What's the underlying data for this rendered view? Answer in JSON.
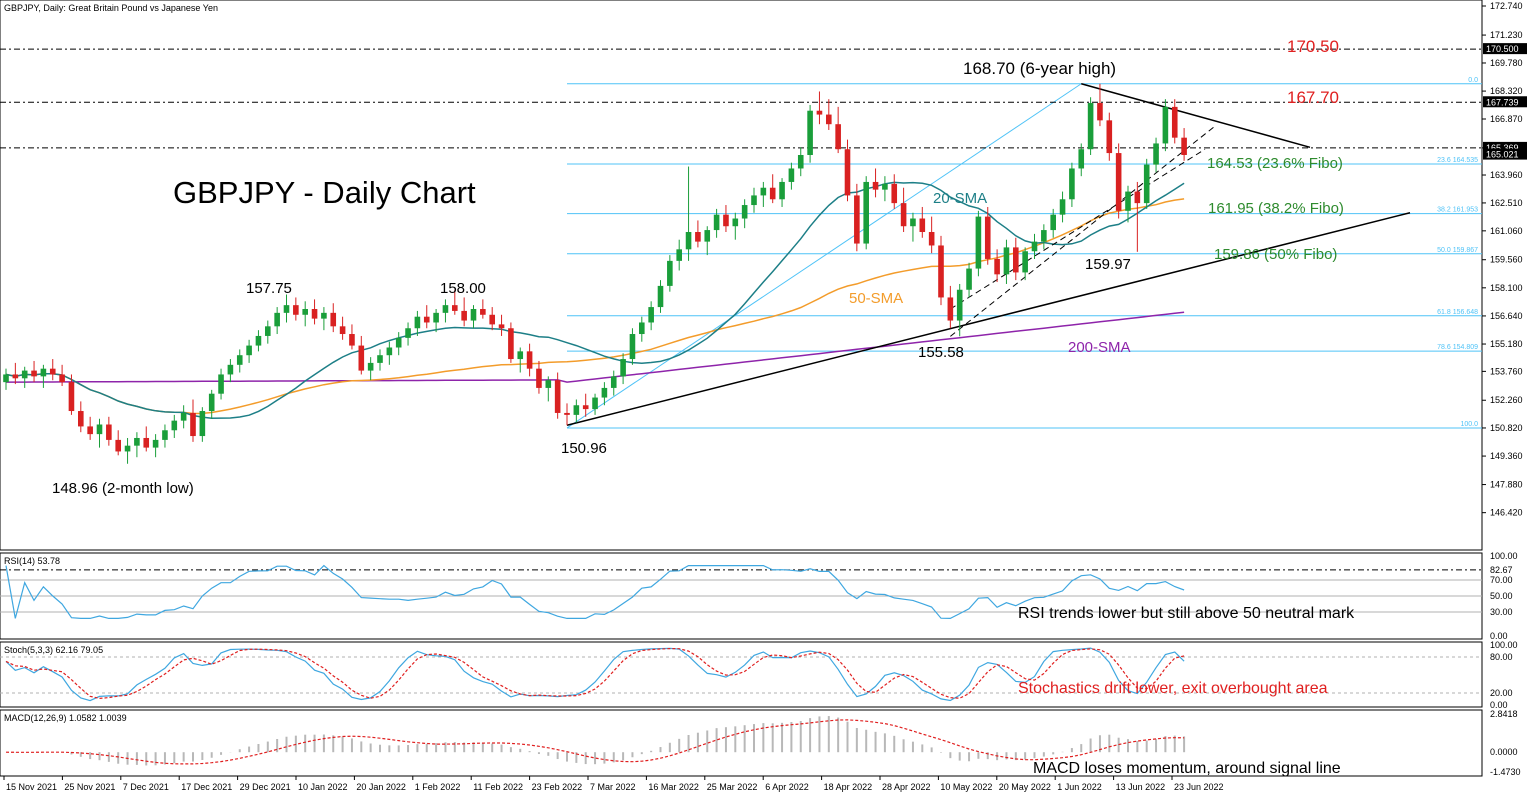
{
  "header": {
    "symbol_info": "GBPJPY, Daily:  Great Britain Pound vs Japanese Yen",
    "chart_title": "GBPJPY - Daily Chart"
  },
  "colors": {
    "bull": "#1a9e3a",
    "bear": "#d92121",
    "sma20": "#1d7f87",
    "sma50": "#f39c2b",
    "sma200": "#8e24aa",
    "fib": "#4fc3f7",
    "annotation_red": "#e02020",
    "annotation_green": "#2e8b2e",
    "rsi": "#3fa7e0",
    "stoch_main": "#3fa7e0",
    "stoch_signal": "#e02020",
    "macd_hist": "#b8b8b8",
    "macd_signal": "#e02020"
  },
  "chart_data": [
    {
      "type": "candlestick",
      "title": "GBPJPY - Daily Chart",
      "ylim": [
        145.0,
        172.74
      ],
      "y_ticks": [
        "172.740",
        "171.230",
        "169.780",
        "168.320",
        "166.870",
        "165.369",
        "163.960",
        "162.510",
        "161.060",
        "159.560",
        "158.100",
        "156.640",
        "155.180",
        "153.760",
        "152.260",
        "150.820",
        "149.360",
        "147.880",
        "146.420"
      ],
      "x_tick_labels": [
        "15 Nov 2021",
        "25 Nov 2021",
        "7 Dec 2021",
        "17 Dec 2021",
        "29 Dec 2021",
        "10 Jan 2022",
        "20 Jan 2022",
        "1 Feb 2022",
        "11 Feb 2022",
        "23 Feb 2022",
        "7 Mar 2022",
        "16 Mar 2022",
        "25 Mar 2022",
        "6 Apr 2022",
        "18 Apr 2022",
        "28 Apr 2022",
        "10 May 2022",
        "20 May 2022",
        "1 Jun 2022",
        "13 Jun 2022",
        "23 Jun 2022"
      ],
      "ohlc": [
        [
          153.2,
          153.9,
          152.8,
          153.6
        ],
        [
          153.6,
          154.2,
          153.1,
          153.4
        ],
        [
          153.4,
          154.0,
          152.9,
          153.8
        ],
        [
          153.8,
          154.3,
          153.2,
          153.5
        ],
        [
          153.5,
          154.1,
          152.9,
          153.9
        ],
        [
          153.9,
          154.4,
          153.3,
          153.6
        ],
        [
          153.6,
          154.1,
          153.0,
          153.2
        ],
        [
          153.2,
          153.6,
          151.5,
          151.7
        ],
        [
          151.7,
          152.2,
          150.6,
          150.9
        ],
        [
          150.9,
          151.4,
          150.2,
          150.5
        ],
        [
          150.5,
          151.3,
          149.8,
          151.0
        ],
        [
          151.0,
          151.4,
          149.9,
          150.2
        ],
        [
          150.2,
          150.7,
          149.4,
          149.6
        ],
        [
          149.6,
          150.3,
          148.96,
          149.9
        ],
        [
          149.9,
          150.6,
          149.3,
          150.3
        ],
        [
          150.3,
          150.9,
          149.6,
          149.8
        ],
        [
          149.8,
          150.5,
          149.3,
          150.2
        ],
        [
          150.2,
          151.0,
          149.8,
          150.7
        ],
        [
          150.7,
          151.5,
          150.3,
          151.2
        ],
        [
          151.2,
          152.0,
          150.8,
          151.6
        ],
        [
          151.6,
          152.3,
          150.1,
          150.4
        ],
        [
          150.4,
          151.9,
          150.1,
          151.7
        ],
        [
          151.7,
          152.8,
          151.3,
          152.6
        ],
        [
          152.6,
          153.9,
          152.3,
          153.6
        ],
        [
          153.6,
          154.4,
          153.2,
          154.1
        ],
        [
          154.1,
          154.9,
          153.7,
          154.6
        ],
        [
          154.6,
          155.4,
          154.2,
          155.1
        ],
        [
          155.1,
          155.9,
          154.8,
          155.6
        ],
        [
          155.6,
          156.4,
          155.2,
          156.1
        ],
        [
          156.1,
          157.1,
          155.7,
          156.8
        ],
        [
          156.8,
          157.75,
          156.3,
          157.2
        ],
        [
          157.2,
          157.6,
          156.4,
          156.7
        ],
        [
          156.7,
          157.4,
          156.1,
          157.0
        ],
        [
          157.0,
          157.5,
          156.2,
          156.5
        ],
        [
          156.5,
          157.1,
          155.9,
          156.8
        ],
        [
          156.8,
          157.3,
          155.8,
          156.1
        ],
        [
          156.1,
          156.6,
          155.4,
          155.7
        ],
        [
          155.7,
          156.2,
          154.9,
          155.1
        ],
        [
          155.1,
          155.6,
          153.6,
          153.8
        ],
        [
          153.8,
          154.5,
          153.3,
          154.2
        ],
        [
          154.2,
          154.9,
          153.8,
          154.6
        ],
        [
          154.6,
          155.3,
          154.1,
          155.0
        ],
        [
          155.0,
          155.8,
          154.6,
          155.5
        ],
        [
          155.5,
          156.3,
          155.1,
          156.0
        ],
        [
          156.0,
          156.9,
          155.6,
          156.6
        ],
        [
          156.6,
          157.2,
          156.0,
          156.3
        ],
        [
          156.3,
          157.0,
          155.8,
          156.8
        ],
        [
          156.8,
          157.5,
          156.3,
          157.2
        ],
        [
          157.2,
          158.0,
          156.7,
          156.9
        ],
        [
          156.9,
          157.6,
          156.1,
          156.4
        ],
        [
          156.4,
          157.2,
          156.0,
          157.0
        ],
        [
          157.0,
          157.5,
          156.5,
          156.7
        ],
        [
          156.7,
          157.1,
          155.9,
          156.2
        ],
        [
          156.2,
          156.7,
          155.6,
          156.0
        ],
        [
          156.0,
          156.3,
          154.2,
          154.4
        ],
        [
          154.4,
          155.0,
          153.7,
          154.8
        ],
        [
          154.8,
          155.2,
          153.5,
          153.9
        ],
        [
          153.9,
          154.3,
          152.6,
          152.9
        ],
        [
          152.9,
          153.5,
          152.2,
          153.3
        ],
        [
          153.3,
          153.7,
          151.3,
          151.6
        ],
        [
          151.6,
          152.1,
          150.96,
          151.5
        ],
        [
          151.5,
          152.3,
          151.1,
          152.0
        ],
        [
          152.0,
          152.6,
          151.4,
          151.8
        ],
        [
          151.8,
          152.6,
          151.5,
          152.4
        ],
        [
          152.4,
          153.2,
          152.0,
          152.9
        ],
        [
          152.9,
          153.8,
          152.5,
          153.5
        ],
        [
          153.5,
          154.7,
          153.1,
          154.4
        ],
        [
          154.4,
          156.0,
          154.1,
          155.7
        ],
        [
          155.7,
          156.6,
          155.3,
          156.3
        ],
        [
          156.3,
          157.4,
          155.9,
          157.1
        ],
        [
          157.1,
          158.5,
          156.8,
          158.2
        ],
        [
          158.2,
          159.8,
          157.9,
          159.5
        ],
        [
          159.5,
          160.6,
          159.0,
          160.1
        ],
        [
          160.1,
          164.4,
          159.5,
          161.0
        ],
        [
          161.0,
          161.6,
          160.2,
          160.5
        ],
        [
          160.5,
          161.3,
          159.8,
          161.1
        ],
        [
          161.1,
          162.2,
          160.7,
          161.9
        ],
        [
          161.9,
          162.4,
          161.0,
          161.3
        ],
        [
          161.3,
          162.0,
          160.6,
          161.7
        ],
        [
          161.7,
          162.7,
          161.2,
          162.4
        ],
        [
          162.4,
          163.3,
          162.0,
          162.9
        ],
        [
          162.9,
          163.6,
          162.3,
          163.3
        ],
        [
          163.3,
          164.0,
          162.5,
          162.7
        ],
        [
          162.7,
          163.8,
          162.3,
          163.6
        ],
        [
          163.6,
          164.6,
          163.2,
          164.3
        ],
        [
          164.3,
          165.4,
          163.9,
          165.0
        ],
        [
          165.0,
          167.6,
          164.6,
          167.3
        ],
        [
          167.3,
          168.3,
          166.6,
          167.1
        ],
        [
          167.1,
          167.9,
          166.3,
          166.6
        ],
        [
          166.6,
          167.5,
          165.1,
          165.3
        ],
        [
          165.3,
          165.8,
          162.6,
          162.9
        ],
        [
          162.9,
          163.5,
          160.0,
          160.4
        ],
        [
          160.4,
          163.9,
          160.1,
          163.6
        ],
        [
          163.6,
          164.3,
          162.8,
          163.2
        ],
        [
          163.2,
          163.9,
          162.6,
          163.5
        ],
        [
          163.5,
          164.0,
          162.2,
          162.5
        ],
        [
          162.5,
          163.3,
          161.0,
          161.3
        ],
        [
          161.3,
          162.0,
          160.5,
          161.7
        ],
        [
          161.7,
          162.3,
          160.7,
          161.0
        ],
        [
          161.0,
          161.8,
          159.9,
          160.3
        ],
        [
          160.3,
          160.8,
          157.2,
          157.6
        ],
        [
          157.6,
          158.2,
          156.0,
          156.4
        ],
        [
          156.4,
          158.3,
          155.58,
          158.0
        ],
        [
          158.0,
          159.4,
          157.6,
          159.1
        ],
        [
          159.1,
          162.1,
          158.7,
          161.8
        ],
        [
          161.8,
          162.3,
          159.3,
          159.6
        ],
        [
          159.6,
          160.1,
          158.4,
          158.8
        ],
        [
          158.8,
          160.6,
          158.3,
          160.2
        ],
        [
          160.2,
          160.7,
          158.5,
          158.9
        ],
        [
          158.9,
          160.2,
          158.5,
          160.0
        ],
        [
          160.0,
          160.9,
          159.6,
          160.5
        ],
        [
          160.5,
          161.4,
          160.1,
          161.1
        ],
        [
          161.1,
          162.2,
          160.7,
          161.9
        ],
        [
          161.9,
          163.1,
          161.5,
          162.7
        ],
        [
          162.7,
          164.6,
          162.3,
          164.3
        ],
        [
          164.3,
          165.6,
          163.9,
          165.3
        ],
        [
          165.3,
          168.0,
          165.0,
          167.7
        ],
        [
          167.7,
          168.7,
          166.5,
          166.8
        ],
        [
          166.8,
          167.2,
          164.7,
          165.1
        ],
        [
          165.1,
          165.6,
          161.7,
          162.1
        ],
        [
          162.1,
          163.4,
          161.5,
          163.1
        ],
        [
          163.1,
          163.6,
          159.97,
          162.5
        ],
        [
          162.5,
          164.8,
          162.2,
          164.5
        ],
        [
          164.5,
          165.9,
          164.1,
          165.6
        ],
        [
          165.6,
          167.9,
          165.2,
          167.5
        ],
        [
          167.5,
          167.9,
          165.6,
          165.9
        ],
        [
          165.9,
          166.4,
          164.7,
          165.0
        ]
      ],
      "series": [
        {
          "name": "20-SMA"
        },
        {
          "name": "50-SMA"
        },
        {
          "name": "200-SMA"
        }
      ],
      "fibonacci": [
        {
          "axis_label": "0.0",
          "value": 168.7
        },
        {
          "axis_label": "23.6 164.535",
          "value": 164.535
        },
        {
          "axis_label": "38.2 161.953",
          "value": 161.953
        },
        {
          "axis_label": "50.0 159.867",
          "value": 159.867
        },
        {
          "axis_label": "61.8 156.648",
          "value": 156.648
        },
        {
          "axis_label": "78.6 154.809",
          "value": 154.809
        },
        {
          "axis_label": "100.0",
          "value": 150.82
        }
      ],
      "horizontal_levels": [
        {
          "axis_label": "170.500",
          "value": 170.5,
          "annotation": "170.50"
        },
        {
          "axis_label": "167.739",
          "value": 167.739,
          "annotation": "167.70"
        },
        {
          "axis_label": "165.369",
          "value": 165.369,
          "annotation": ""
        },
        {
          "axis_label": "165.021",
          "value": 165.021,
          "annotation": ""
        }
      ],
      "annotations": {
        "high_label": "168.70 (6-year high)",
        "low_2month": "148.96 (2-month low)",
        "peak_157": "157.75",
        "peak_158": "158.00",
        "low_150": "150.96",
        "low_155": "155.58",
        "low_159": "159.97",
        "fib_236": "164.53 (23.6% Fibo)",
        "fib_382": "161.95 (38.2% Fibo)",
        "fib_500": "159.86 (50% Fibo)",
        "sma20": "20-SMA",
        "sma50": "50-SMA",
        "sma200": "200-SMA"
      }
    },
    {
      "type": "line",
      "name": "RSI(14)",
      "header": "RSI(14) 53.78",
      "ylim": [
        0,
        100
      ],
      "y_ticks": [
        "100.00",
        "82.67",
        "70.00",
        "50.00",
        "30.00",
        "0.00"
      ],
      "note": "RSI trends lower but still above 50 neutral mark"
    },
    {
      "type": "line",
      "name": "Stoch(5,3,3)",
      "header": "Stoch(5,3,3) 62.16 79.05",
      "ylim": [
        0,
        100
      ],
      "y_ticks": [
        "100.00",
        "80.00",
        "20.00",
        "0.00"
      ],
      "note": "Stochastics drift lower, exit overbought area"
    },
    {
      "type": "bar",
      "name": "MACD(12,26,9)",
      "header": "MACD(12,26,9) 1.0582 1.0039",
      "y_ticks": [
        "2.8418",
        "0.0000",
        "-1.4730"
      ],
      "note": "MACD loses momentum, around signal line"
    }
  ]
}
